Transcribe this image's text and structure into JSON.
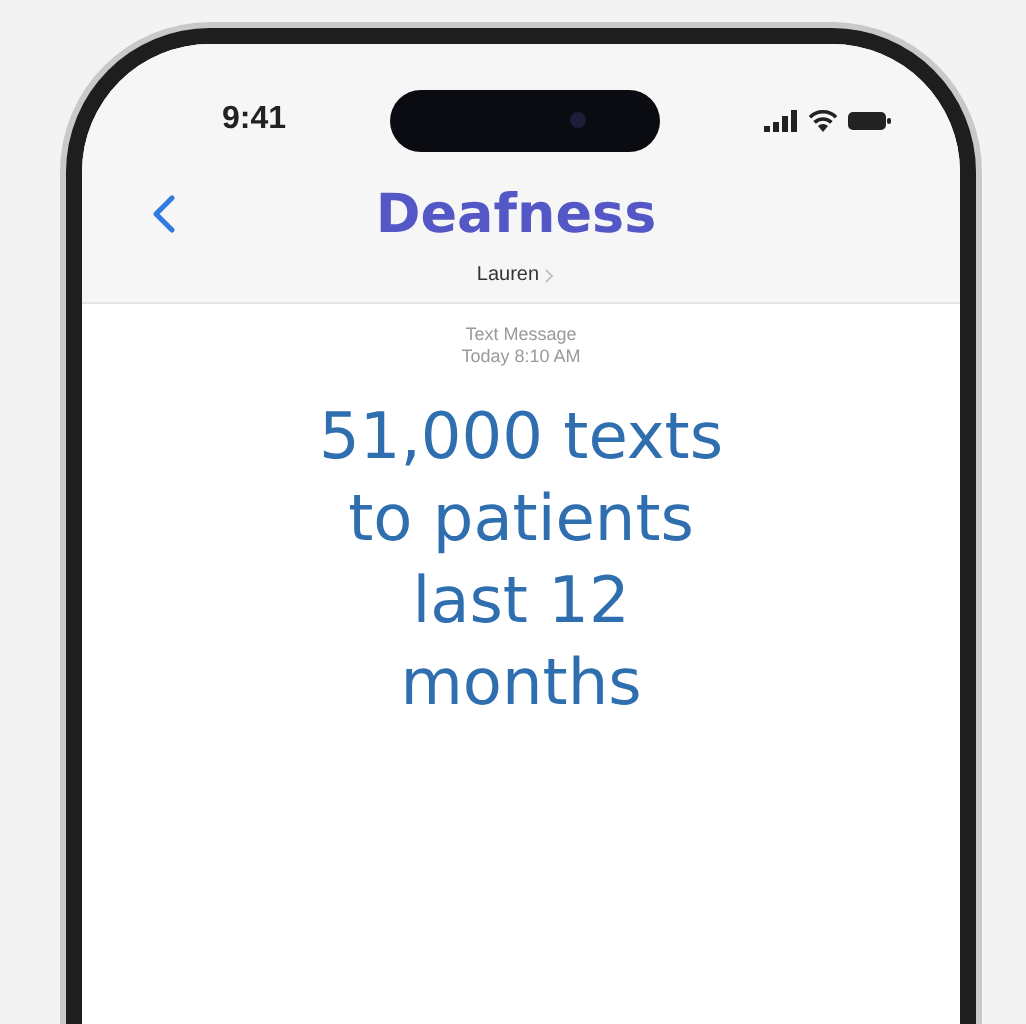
{
  "status_bar": {
    "time": "9:41"
  },
  "header": {
    "title": "Deafness",
    "contact": "Lauren"
  },
  "message": {
    "service": "Text Message",
    "timestamp": "Today 8:10 AM",
    "lines": [
      "51,000 texts",
      "to patients",
      "last 12",
      "months"
    ]
  }
}
